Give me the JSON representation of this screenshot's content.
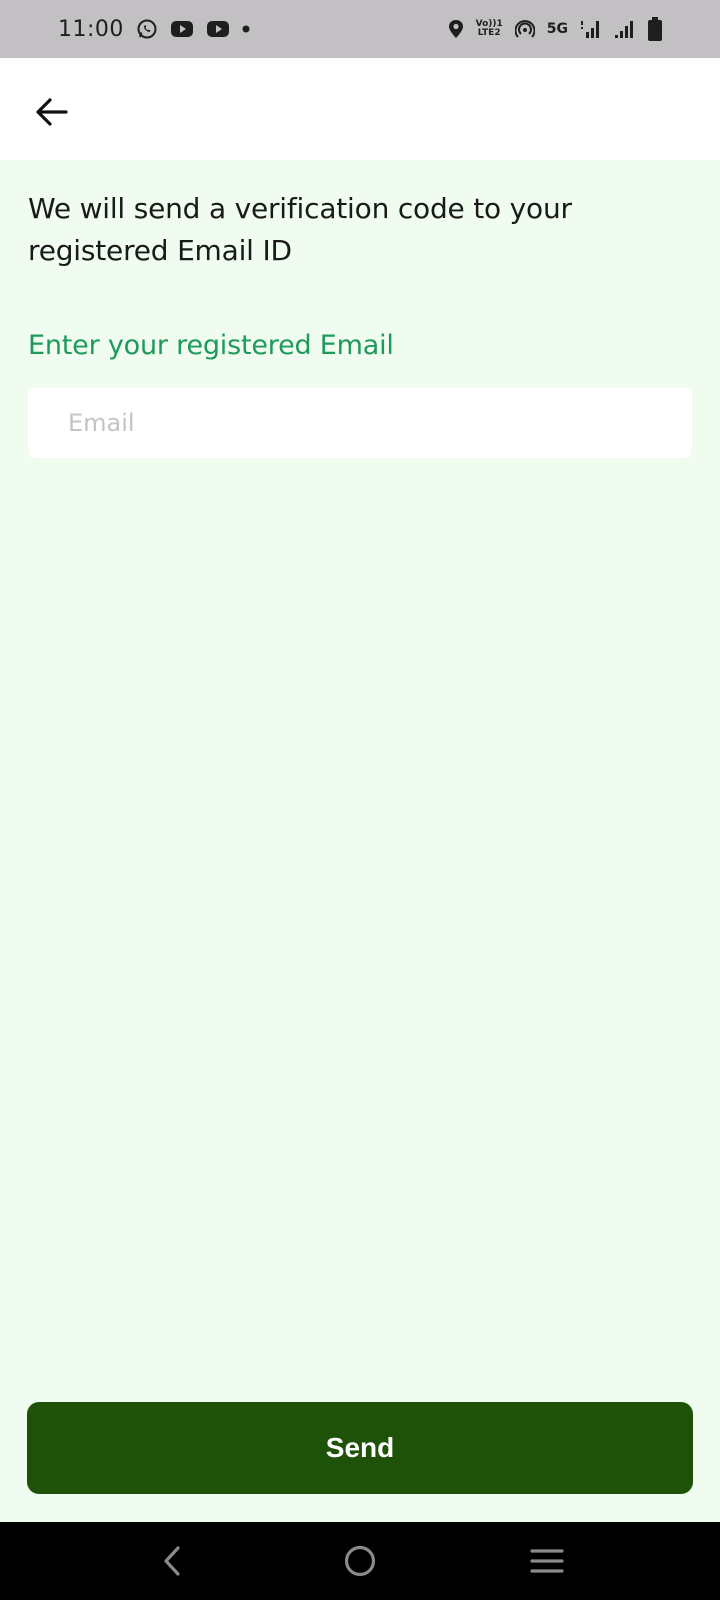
{
  "status_bar": {
    "time": "11:00",
    "network_type": "5G",
    "volte_top": "Vo))1",
    "volte_bottom": "LTE2",
    "icons": [
      "whatsapp-icon",
      "youtube-icon",
      "youtube-icon",
      "dot-icon",
      "location-icon",
      "volte-icon",
      "hotspot-icon",
      "signal-icon",
      "signal-icon",
      "battery-icon"
    ]
  },
  "header": {
    "back_icon": "arrow-left-icon"
  },
  "main": {
    "description": "We will send a verification code to your registered Email ID",
    "email_label": "Enter your registered Email",
    "email_input": {
      "value": "",
      "placeholder": "Email"
    },
    "send_label": "Send"
  },
  "nav_bar": {
    "icons": [
      "nav-back-icon",
      "nav-home-icon",
      "nav-menu-icon"
    ]
  },
  "colors": {
    "background": "#f1fcf0",
    "label_green": "#1e9a5c",
    "button_green": "#1f5209",
    "status_bar": "#c2c0c2"
  }
}
